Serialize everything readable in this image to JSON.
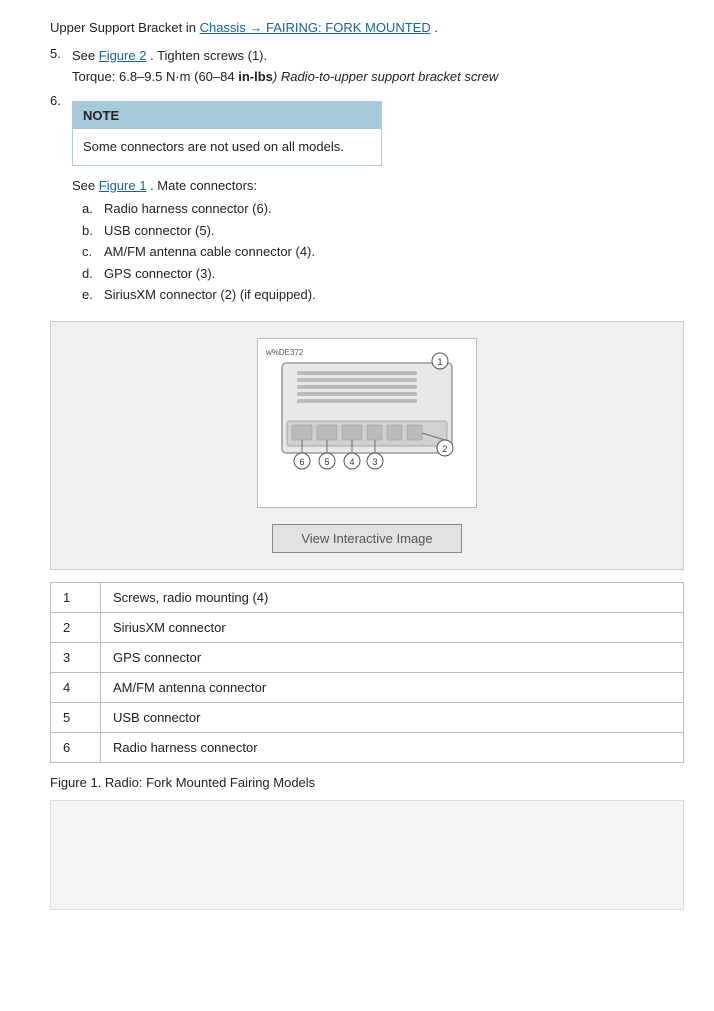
{
  "page": {
    "intro": {
      "line1_prefix": "Upper Support Bracket in ",
      "link1_text": "Chassis → FAIRING: FORK MOUNTED",
      "line1_suffix": "."
    },
    "steps": [
      {
        "num": "5.",
        "line1_prefix": "See ",
        "link_text": "Figure 2",
        "line1_suffix": ". Tighten screws (1).",
        "torque": "Torque: 6.8–9.5 N·m (60–84 ",
        "torque_bold": "in-lbs",
        "torque_italic": ") Radio-to-upper support bracket screw"
      },
      {
        "num": "6.",
        "content": ""
      }
    ],
    "note": {
      "header": "NOTE",
      "body": "Some connectors are not used on all models."
    },
    "see_figure": {
      "prefix": "See ",
      "link": "Figure 1",
      "suffix": ". Mate connectors:"
    },
    "connectors": [
      {
        "letter": "a.",
        "text": "Radio harness connector (6)."
      },
      {
        "letter": "b.",
        "text": "USB connector (5)."
      },
      {
        "letter": "c.",
        "text": "AM/FM antenna cable connector (4)."
      },
      {
        "letter": "d.",
        "text": "GPS connector (3)."
      },
      {
        "letter": "e.",
        "text": "SiriusXM connector (2) (if equipped)."
      }
    ],
    "figure": {
      "img_id": "w%DE372",
      "view_btn_label": "View Interactive Image"
    },
    "table": {
      "rows": [
        {
          "num": "1",
          "desc": "Screws, radio mounting (4)"
        },
        {
          "num": "2",
          "desc": "SiriusXM connector"
        },
        {
          "num": "3",
          "desc": "GPS connector"
        },
        {
          "num": "4",
          "desc": "AM/FM antenna connector"
        },
        {
          "num": "5",
          "desc": "USB connector"
        },
        {
          "num": "6",
          "desc": "Radio harness connector"
        }
      ]
    },
    "caption": "Figure 1. Radio: Fork Mounted Fairing Models"
  }
}
